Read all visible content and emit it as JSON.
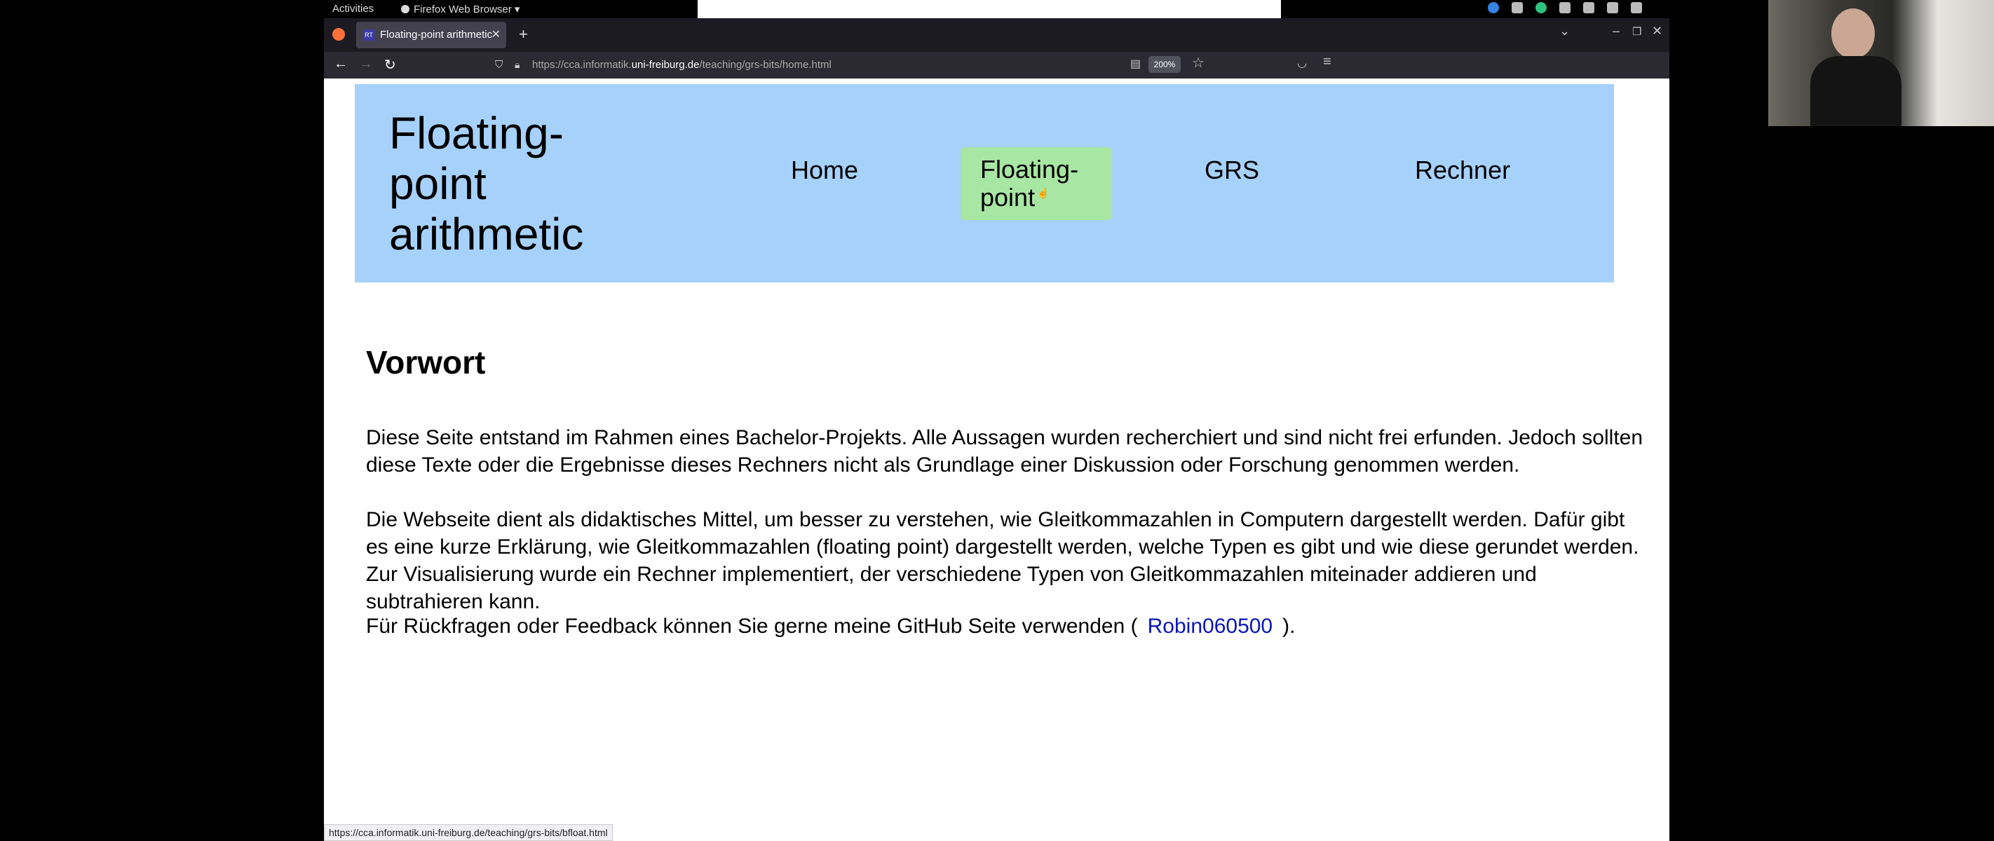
{
  "topbar": {
    "activities": "Activities",
    "app_menu": "Firefox Web Browser ▾"
  },
  "browser": {
    "tab_title": "Floating-point arithmetic",
    "tab_favicon": "RT",
    "url_prefix": "https://cca.informatik.",
    "url_domain": "uni-freiburg.de",
    "url_path": "/teaching/grs-bits/home.html",
    "zoom": "200%",
    "status_url": "https://cca.informatik.uni-freiburg.de/teaching/grs-bits/bfloat.html"
  },
  "page": {
    "site_title": "Floating-point arithmetic",
    "nav": {
      "home": "Home",
      "floating_point": "Floating-point",
      "grs": "GRS",
      "rechner": "Rechner"
    },
    "heading": "Vorwort",
    "paragraph1": "Diese Seite entstand im Rahmen eines Bachelor-Projekts. Alle Aussagen wurden recherchiert und sind nicht frei erfunden. Jedoch sollten diese Texte oder die Ergebnisse dieses Rechners nicht als Grundlage einer Diskussion oder Forschung genommen werden.",
    "paragraph2": "Die Webseite dient als didaktisches Mittel, um besser zu verstehen, wie Gleitkommazahlen in Computern dargestellt werden. Dafür gibt es eine kurze Erklärung, wie Gleitkommazahlen (floating point) dargestellt werden, welche Typen es gibt und wie diese gerundet werden. Zur Visualisierung wurde ein Rechner implementiert, der verschiedene Typen von Gleitkommazahlen miteinader addieren und subtrahieren kann.",
    "paragraph3_before": "Für Rückfragen oder Feedback können Sie gerne meine GitHub Seite verwenden (",
    "github_link": "Robin060500",
    "paragraph3_after": ")."
  },
  "colors": {
    "header_bg": "#a6d1fa",
    "active_nav_bg": "#a8e6a3",
    "link": "#0a15b8"
  }
}
